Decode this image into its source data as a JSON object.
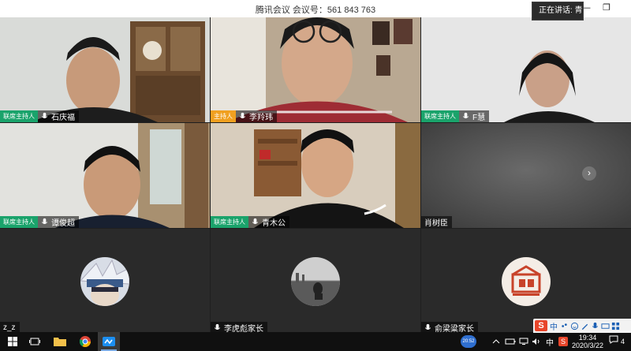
{
  "window": {
    "title": "腾讯会议  会议号：561 843 763",
    "speaking_label": "正在讲话: 青",
    "minimize_glyph": "—",
    "maximize_glyph": "❐"
  },
  "tiles": [
    {
      "role": "联席主持人",
      "name": "石庆福"
    },
    {
      "role": "主持人",
      "name": "李羚玮"
    },
    {
      "role": "联席主持人",
      "name": "F慧"
    },
    {
      "role": "联席主持人",
      "name": "谭俊超"
    },
    {
      "role": "联席主持人",
      "name": "青木公"
    },
    {
      "role": "",
      "name": "肖树臣"
    },
    {
      "role": "",
      "name": "z_z"
    },
    {
      "role": "",
      "name": "李虎彪家长"
    },
    {
      "role": "",
      "name": "俞梁粱家长"
    }
  ],
  "next_page_glyph": "›",
  "ime": {
    "logo": "S",
    "mode": "中"
  },
  "taskbar": {
    "tray_badge": "20:52",
    "tray_lang": "中",
    "time": "19:34",
    "date": "2020/3/22",
    "notifications": "4"
  },
  "colors": {
    "co_host": "#1aa36b",
    "host": "#f0a020",
    "taskbar": "#101010"
  }
}
